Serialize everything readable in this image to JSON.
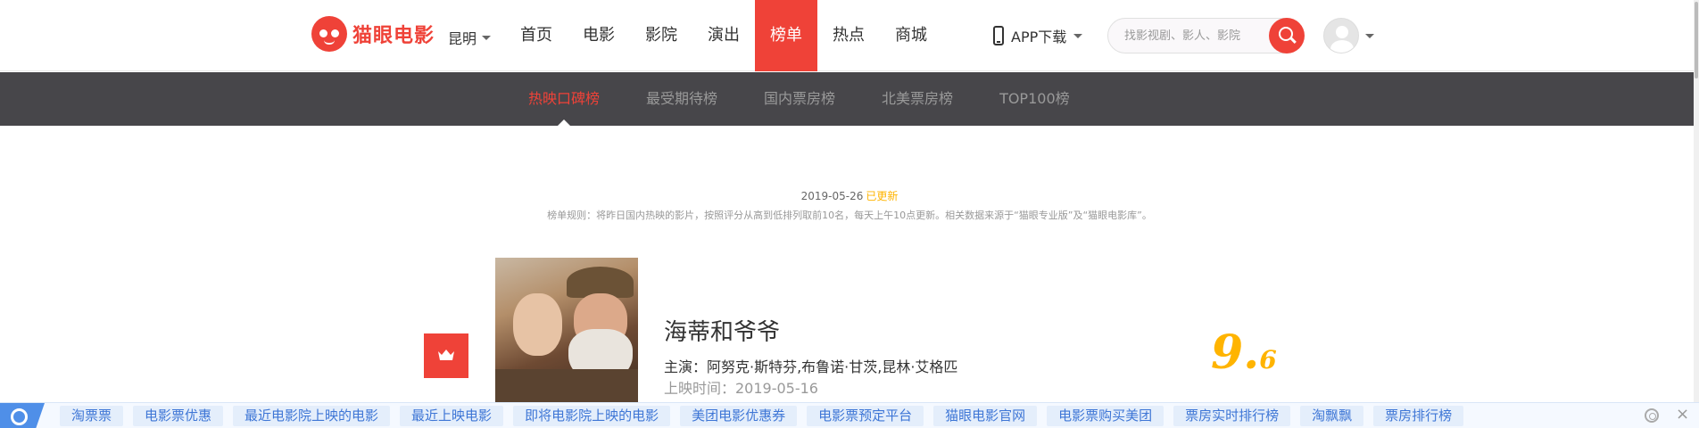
{
  "brand": {
    "name": "猫眼电影",
    "accent": "#ef4238"
  },
  "header": {
    "city": "昆明",
    "nav": [
      {
        "label": "首页",
        "active": false
      },
      {
        "label": "电影",
        "active": false
      },
      {
        "label": "影院",
        "active": false
      },
      {
        "label": "演出",
        "active": false
      },
      {
        "label": "榜单",
        "active": true
      },
      {
        "label": "热点",
        "active": false
      },
      {
        "label": "商城",
        "active": false
      }
    ],
    "app_download": "APP下载",
    "search_placeholder": "找影视剧、影人、影院"
  },
  "subnav": {
    "items": [
      {
        "label": "热映口碑榜",
        "active": true
      },
      {
        "label": "最受期待榜",
        "active": false
      },
      {
        "label": "国内票房榜",
        "active": false
      },
      {
        "label": "北美票房榜",
        "active": false
      },
      {
        "label": "TOP100榜",
        "active": false
      }
    ]
  },
  "board": {
    "date": "2019-05-26",
    "updated_tag": "已更新",
    "rule": "榜单规则：将昨日国内热映的影片，按照评分从高到低排列取前10名，每天上午10点更新。相关数据来源于“猫眼专业版”及“猫眼电影库”。"
  },
  "movie": {
    "title": "海蒂和爷爷",
    "cast": "主演：阿努克·斯特芬,布鲁诺·甘茨,昆林·艾格匹",
    "release": "上映时间：2019-05-16",
    "score_int": "9.",
    "score_dec": "6",
    "score_color": "#ffb400"
  },
  "bottombar": {
    "links": [
      "淘票票",
      "电影票优惠",
      "最近电影院上映的电影",
      "最近上映电影",
      "即将电影院上映的电影",
      "美团电影优惠券",
      "电影票预定平台",
      "猫眼电影官网",
      "电影票购买美团",
      "票房实时排行榜",
      "淘飘飘",
      "票房排行榜"
    ],
    "close": "×"
  }
}
